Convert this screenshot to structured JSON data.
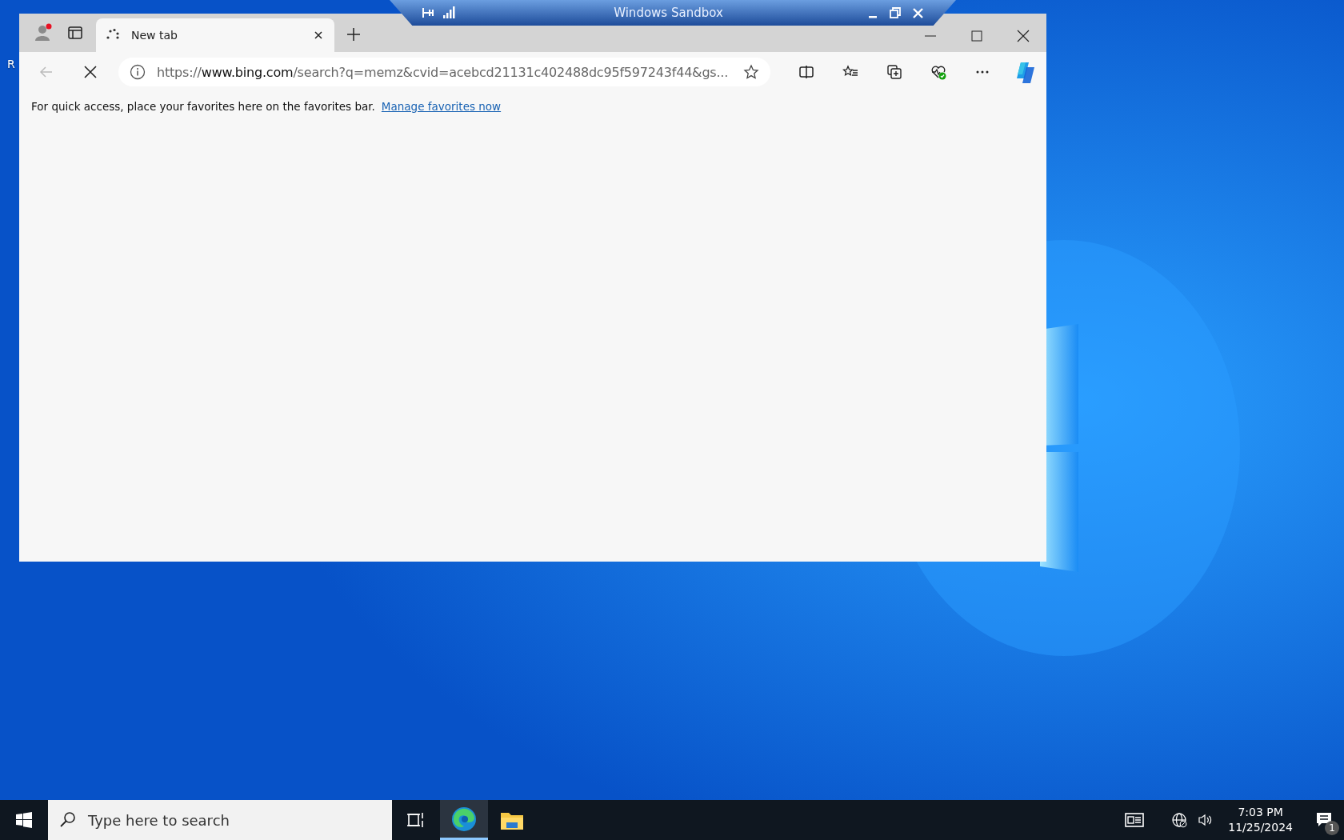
{
  "desktop": {
    "icon_label": "R"
  },
  "sandbox_bar": {
    "title": "Windows Sandbox"
  },
  "browser": {
    "tabs": [
      {
        "title": "New tab",
        "selected": true,
        "loading": true
      }
    ],
    "address": {
      "parts": [
        {
          "text": "https://",
          "kind": "dim"
        },
        {
          "text": "www.bing.com",
          "kind": "host"
        },
        {
          "text": "/search?q=memz&cvid=acebcd21131c402488dc95f597243f44&gs...",
          "kind": "dim"
        }
      ]
    },
    "loading": true,
    "favorites_bar": {
      "message": "For quick access, place your favorites here on the favorites bar.",
      "link": "Manage favorites now"
    }
  },
  "taskbar": {
    "search_placeholder": "Type here to search",
    "apps": [
      {
        "kind": "task-view",
        "selected": false
      },
      {
        "kind": "edge",
        "selected": true
      },
      {
        "kind": "explorer",
        "selected": false
      }
    ],
    "time": "7:03 PM",
    "date": "11/25/2024",
    "notification_count": "1"
  }
}
